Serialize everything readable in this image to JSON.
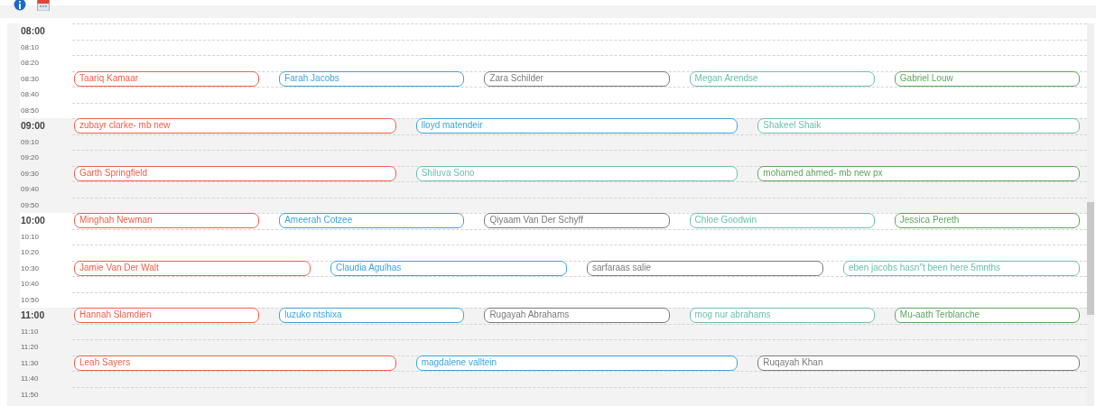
{
  "toolbar": {
    "buttons": [
      {
        "kind": "info"
      },
      {
        "kind": "calendar"
      }
    ]
  },
  "hours": [
    {
      "shaded": false,
      "rows": [
        {
          "time": "08:00",
          "appointments": []
        },
        {
          "time": "08:10",
          "appointments": []
        },
        {
          "time": "08:20",
          "appointments": []
        },
        {
          "time": "08:30",
          "appointments": [
            {
              "name": "Taariq Kamaar",
              "color": "#f0604a"
            },
            {
              "name": "Farah Jacobs",
              "color": "#3aa5dc"
            },
            {
              "name": "Zara Schilder",
              "color": "#7a7a7a"
            },
            {
              "name": "Megan Arendse",
              "color": "#6cc0ae"
            },
            {
              "name": "Gabriel Louw",
              "color": "#5ea55e"
            }
          ]
        },
        {
          "time": "08:40",
          "appointments": []
        },
        {
          "time": "08:50",
          "appointments": []
        }
      ]
    },
    {
      "shaded": true,
      "rows": [
        {
          "time": "09:00",
          "appointments": [
            {
              "name": "zubayr clarke- mb new",
              "color": "#f0604a"
            },
            {
              "name": "lloyd matendeir",
              "color": "#3aa5dc"
            },
            {
              "name": "Shakeel Shaik",
              "color": "#6cc0ae"
            }
          ]
        },
        {
          "time": "09:10",
          "appointments": []
        },
        {
          "time": "09:20",
          "appointments": []
        },
        {
          "time": "09:30",
          "appointments": [
            {
              "name": "Garth Springfield",
              "color": "#f0604a"
            },
            {
              "name": "Shiluva Sono",
              "color": "#6cc0ae"
            },
            {
              "name": "mohamed ahmed- mb new px",
              "color": "#5ea55e"
            }
          ]
        },
        {
          "time": "09:40",
          "appointments": []
        },
        {
          "time": "09:50",
          "appointments": []
        }
      ]
    },
    {
      "shaded": false,
      "rows": [
        {
          "time": "10:00",
          "appointments": [
            {
              "name": "Minghah Newman",
              "color": "#f0604a"
            },
            {
              "name": "Ameerah Cotzee",
              "color": "#3aa5dc"
            },
            {
              "name": "Qiyaam Van Der Schyff",
              "color": "#7a7a7a"
            },
            {
              "name": "Chloe Goodwin",
              "color": "#6cc0ae"
            },
            {
              "name": "Jessica Pereth",
              "color": "#5ea55e"
            }
          ]
        },
        {
          "time": "10:10",
          "appointments": []
        },
        {
          "time": "10:20",
          "appointments": []
        },
        {
          "time": "10:30",
          "appointments": [
            {
              "name": "Jamie Van Der Walt",
              "color": "#f0604a"
            },
            {
              "name": "Claudia Agulhas",
              "color": "#3aa5dc"
            },
            {
              "name": "sarfaraas salie",
              "color": "#7a7a7a"
            },
            {
              "name": "eben jacobs hasn\"t been here 5mnths",
              "color": "#6cc0ae"
            }
          ]
        },
        {
          "time": "10:40",
          "appointments": []
        },
        {
          "time": "10:50",
          "appointments": []
        }
      ]
    },
    {
      "shaded": true,
      "rows": [
        {
          "time": "11:00",
          "appointments": [
            {
              "name": "Hannah Slamdien",
              "color": "#f0604a"
            },
            {
              "name": "luzuko ntshixa",
              "color": "#3aa5dc"
            },
            {
              "name": "Rugayah Abrahams",
              "color": "#7a7a7a"
            },
            {
              "name": "mog nur abrahams",
              "color": "#6cc0ae"
            },
            {
              "name": "Mu-aath Terblanche",
              "color": "#5ea55e"
            }
          ]
        },
        {
          "time": "11:10",
          "appointments": []
        },
        {
          "time": "11:20",
          "appointments": []
        },
        {
          "time": "11:30",
          "appointments": [
            {
              "name": "Leah Sayers",
              "color": "#f0604a"
            },
            {
              "name": "magdalene valltein",
              "color": "#3aa5dc"
            },
            {
              "name": "Ruqayah Khan",
              "color": "#7a7a7a"
            }
          ]
        },
        {
          "time": "11:40",
          "appointments": []
        },
        {
          "time": "11:50",
          "appointments": []
        }
      ]
    }
  ]
}
